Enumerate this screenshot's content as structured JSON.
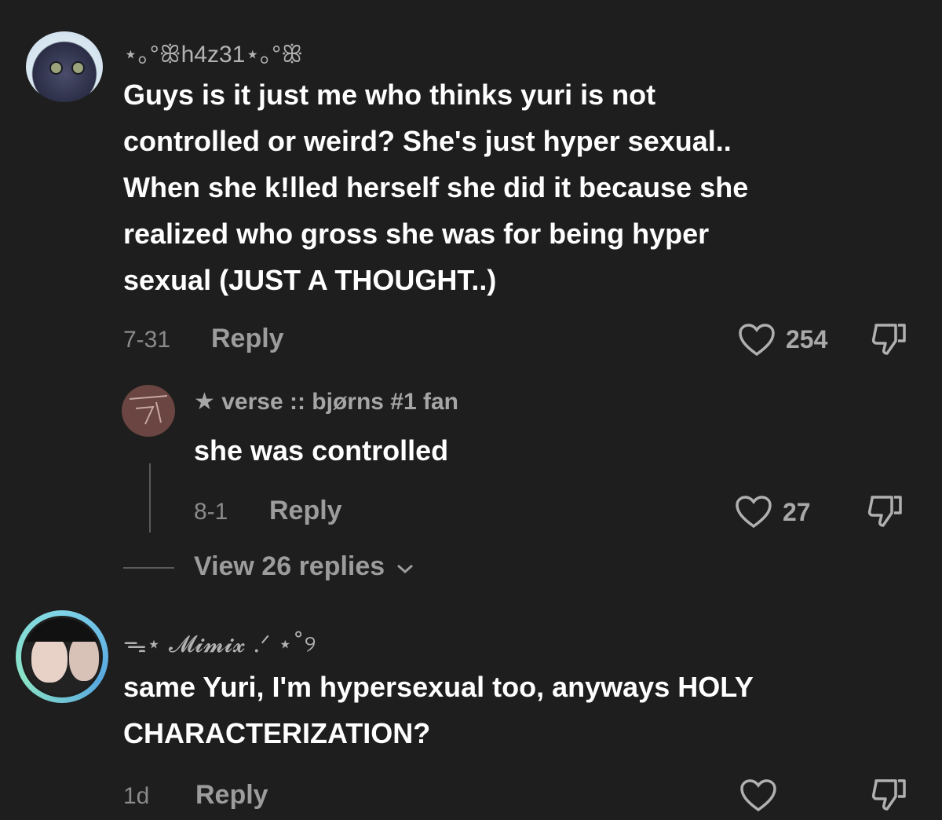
{
  "comments": [
    {
      "username": "⋆｡°ꕥh4z31⋆｡°ꕥ",
      "text_lines": [
        "Guys is it just me who thinks yuri is not",
        "controlled or weird? She's just hyper sexual..",
        "When she k!lled herself she did it because she",
        "realized who gross she was for being hyper",
        "sexual (JUST A THOUGHT..)"
      ],
      "date": "7-31",
      "reply_label": "Reply",
      "likes": "254"
    },
    {
      "username": "★ verse :: bjørns #1 fan",
      "text": "she was controlled",
      "date": "8-1",
      "reply_label": "Reply",
      "likes": "27"
    },
    {
      "username": "ᯓ⋆ 𝓜𝓲𝓶𝓲𝔁 .ᐟ ⋆˚୨",
      "text_lines": [
        "same Yuri, I'm hypersexual too, anyways HOLY",
        "CHARACTERIZATION?"
      ],
      "date": "1d",
      "reply_label": "Reply"
    }
  ],
  "view_replies_label": "View 26 replies",
  "icons": [
    "heart-icon",
    "dislike-icon",
    "chevron-down-icon"
  ],
  "colors": {
    "background": "#1e1e1e",
    "text": "#ffffff",
    "muted": "#9c9c9c",
    "avatar_ring": "#58a8e0"
  }
}
